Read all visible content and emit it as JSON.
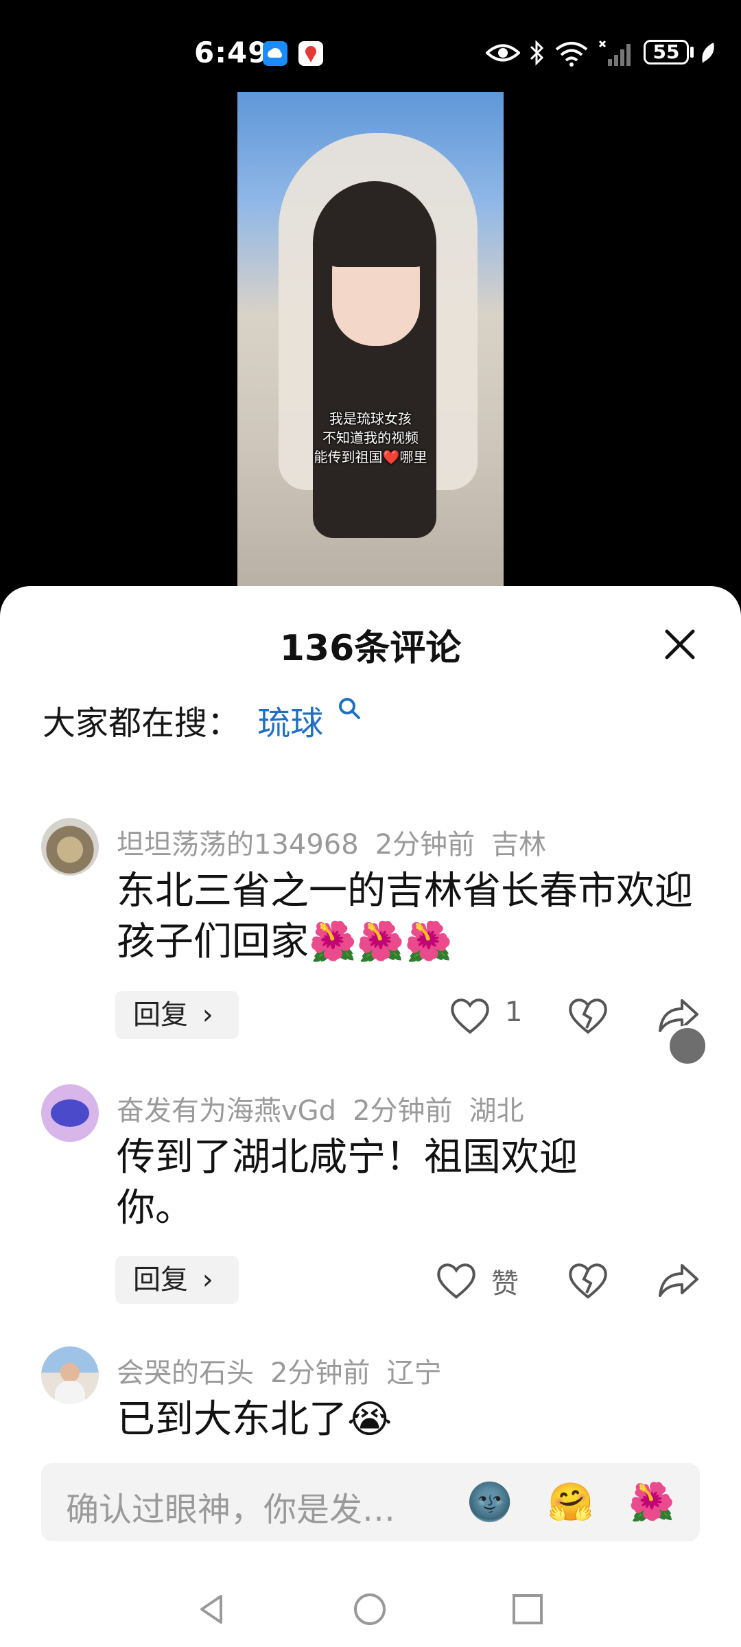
{
  "status_bar": {
    "time": "6:49",
    "battery": "55"
  },
  "video": {
    "caption_lines": [
      "我是琉球女孩",
      "不知道我的视频",
      "能传到祖国❤️哪里"
    ]
  },
  "comments_panel": {
    "title": "136条评论",
    "search_label": "大家都在搜：",
    "search_keyword": "琉球",
    "comments": [
      {
        "username": "坦坦荡荡的134968",
        "time": "2分钟前",
        "location": "吉林",
        "text": "东北三省之一的吉林省长春市欢迎孩子们回家🌺🌺🌺",
        "reply_label": "回复",
        "like_count": "1"
      },
      {
        "username": "奋发有为海燕vGd",
        "time": "2分钟前",
        "location": "湖北",
        "text": "传到了湖北咸宁！祖国欢迎你。",
        "reply_label": "回复",
        "like_count": "赞"
      },
      {
        "username": "会哭的石头",
        "time": "2分钟前",
        "location": "辽宁",
        "text": "已到大东北了😭"
      }
    ],
    "input_placeholder": "确认过眼神，你是发…",
    "quick_emojis": [
      "🌚",
      "🤗",
      "🌺"
    ]
  },
  "colors": {
    "accent_link": "#1f6fc3",
    "meta_gray": "#9a9a9a"
  }
}
